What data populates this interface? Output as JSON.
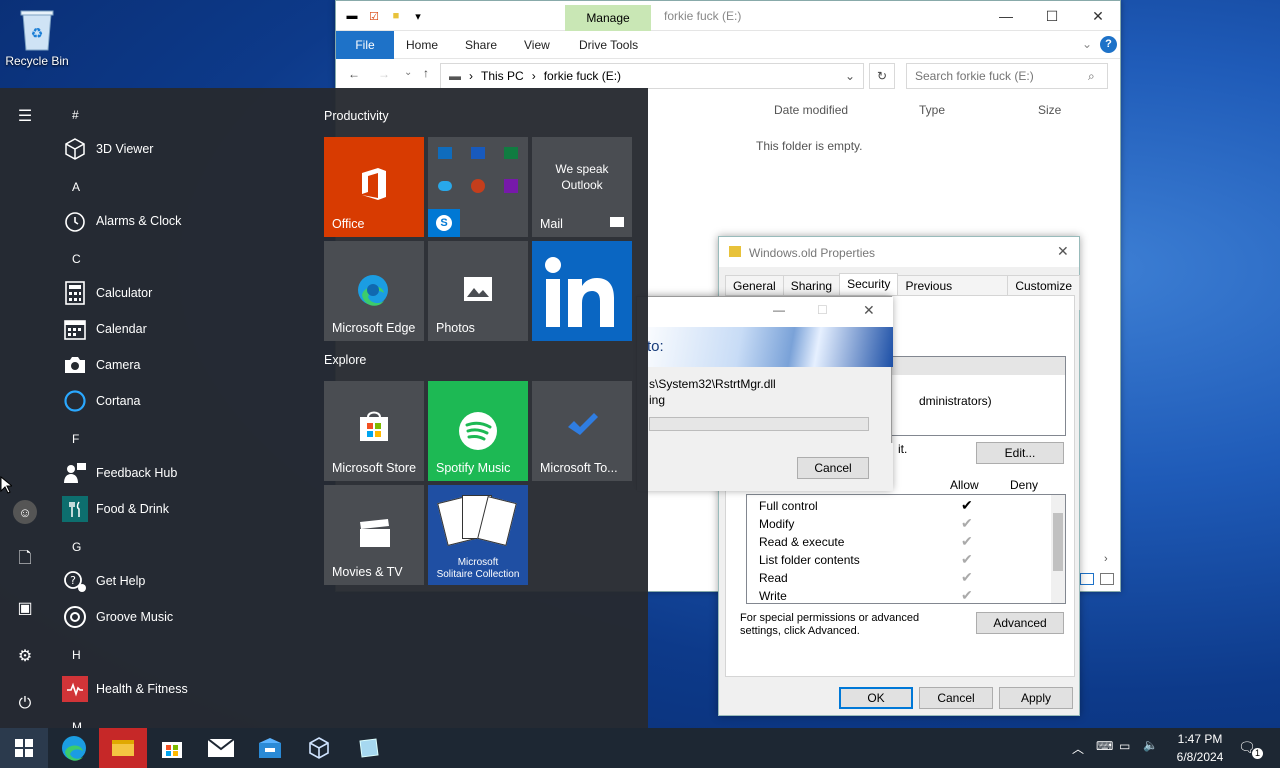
{
  "desktop": {
    "recycle_bin": "Recycle Bin"
  },
  "explorer": {
    "title": "forkie fuck (E:)",
    "manage_tab": "Manage",
    "ribbon_tabs": [
      "File",
      "Home",
      "Share",
      "View",
      "Drive Tools"
    ],
    "address": {
      "root": "This PC",
      "current": "forkie fuck (E:)"
    },
    "search_placeholder": "Search forkie fuck (E:)",
    "columns": [
      "Date modified",
      "Type",
      "Size"
    ],
    "empty_message": "This folder is empty."
  },
  "properties": {
    "title": "Windows.old Properties",
    "tabs": [
      "General",
      "Sharing",
      "Security",
      "Previous Versions",
      "Customize"
    ],
    "selected_tab": "Security",
    "group_fragment": "dministrators)",
    "fragment_it": "it.",
    "edit_button": "Edit...",
    "allow_header": "Allow",
    "deny_header": "Deny",
    "permissions": [
      "Full control",
      "Modify",
      "Read & execute",
      "List folder contents",
      "Read",
      "Write"
    ],
    "advanced_note": "For special permissions or advanced settings, click Advanced.",
    "advanced_button": "Advanced",
    "ok_button": "OK",
    "cancel_button": "Cancel",
    "apply_button": "Apply"
  },
  "copy_dialog": {
    "heading_fragment": "to:",
    "path_fragment": "s\\System32\\RstrtMgr.dll",
    "status_fragment": "ing",
    "cancel_button": "Cancel"
  },
  "start_menu": {
    "apps": [
      {
        "letter": "#"
      },
      {
        "name": "3D Viewer"
      },
      {
        "letter": "A"
      },
      {
        "name": "Alarms & Clock"
      },
      {
        "letter": "C"
      },
      {
        "name": "Calculator"
      },
      {
        "name": "Calendar"
      },
      {
        "name": "Camera"
      },
      {
        "name": "Cortana"
      },
      {
        "letter": "F"
      },
      {
        "name": "Feedback Hub"
      },
      {
        "name": "Food & Drink"
      },
      {
        "letter": "G"
      },
      {
        "name": "Get Help"
      },
      {
        "name": "Groove Music"
      },
      {
        "letter": "H"
      },
      {
        "name": "Health & Fitness"
      },
      {
        "letter": "M"
      }
    ],
    "groups": [
      "Productivity",
      "Explore"
    ],
    "tiles": {
      "office": "Office",
      "mail_promo": "We speak Outlook",
      "mail": "Mail",
      "edge": "Microsoft Edge",
      "photos": "Photos",
      "store": "Microsoft Store",
      "spotify": "Spotify Music",
      "todo": "Microsoft To...",
      "movies": "Movies & TV",
      "solitaire_line1": "Microsoft",
      "solitaire_line2": "Solitaire Collection"
    }
  },
  "taskbar": {
    "time": "1:47 PM",
    "date": "6/8/2024",
    "notification_count": "1"
  },
  "colors": {
    "office": "#d83b01",
    "spotify": "#1db954",
    "linkedin": "#0a66c2",
    "start_bg": "#262a30",
    "accent": "#0078d7"
  }
}
